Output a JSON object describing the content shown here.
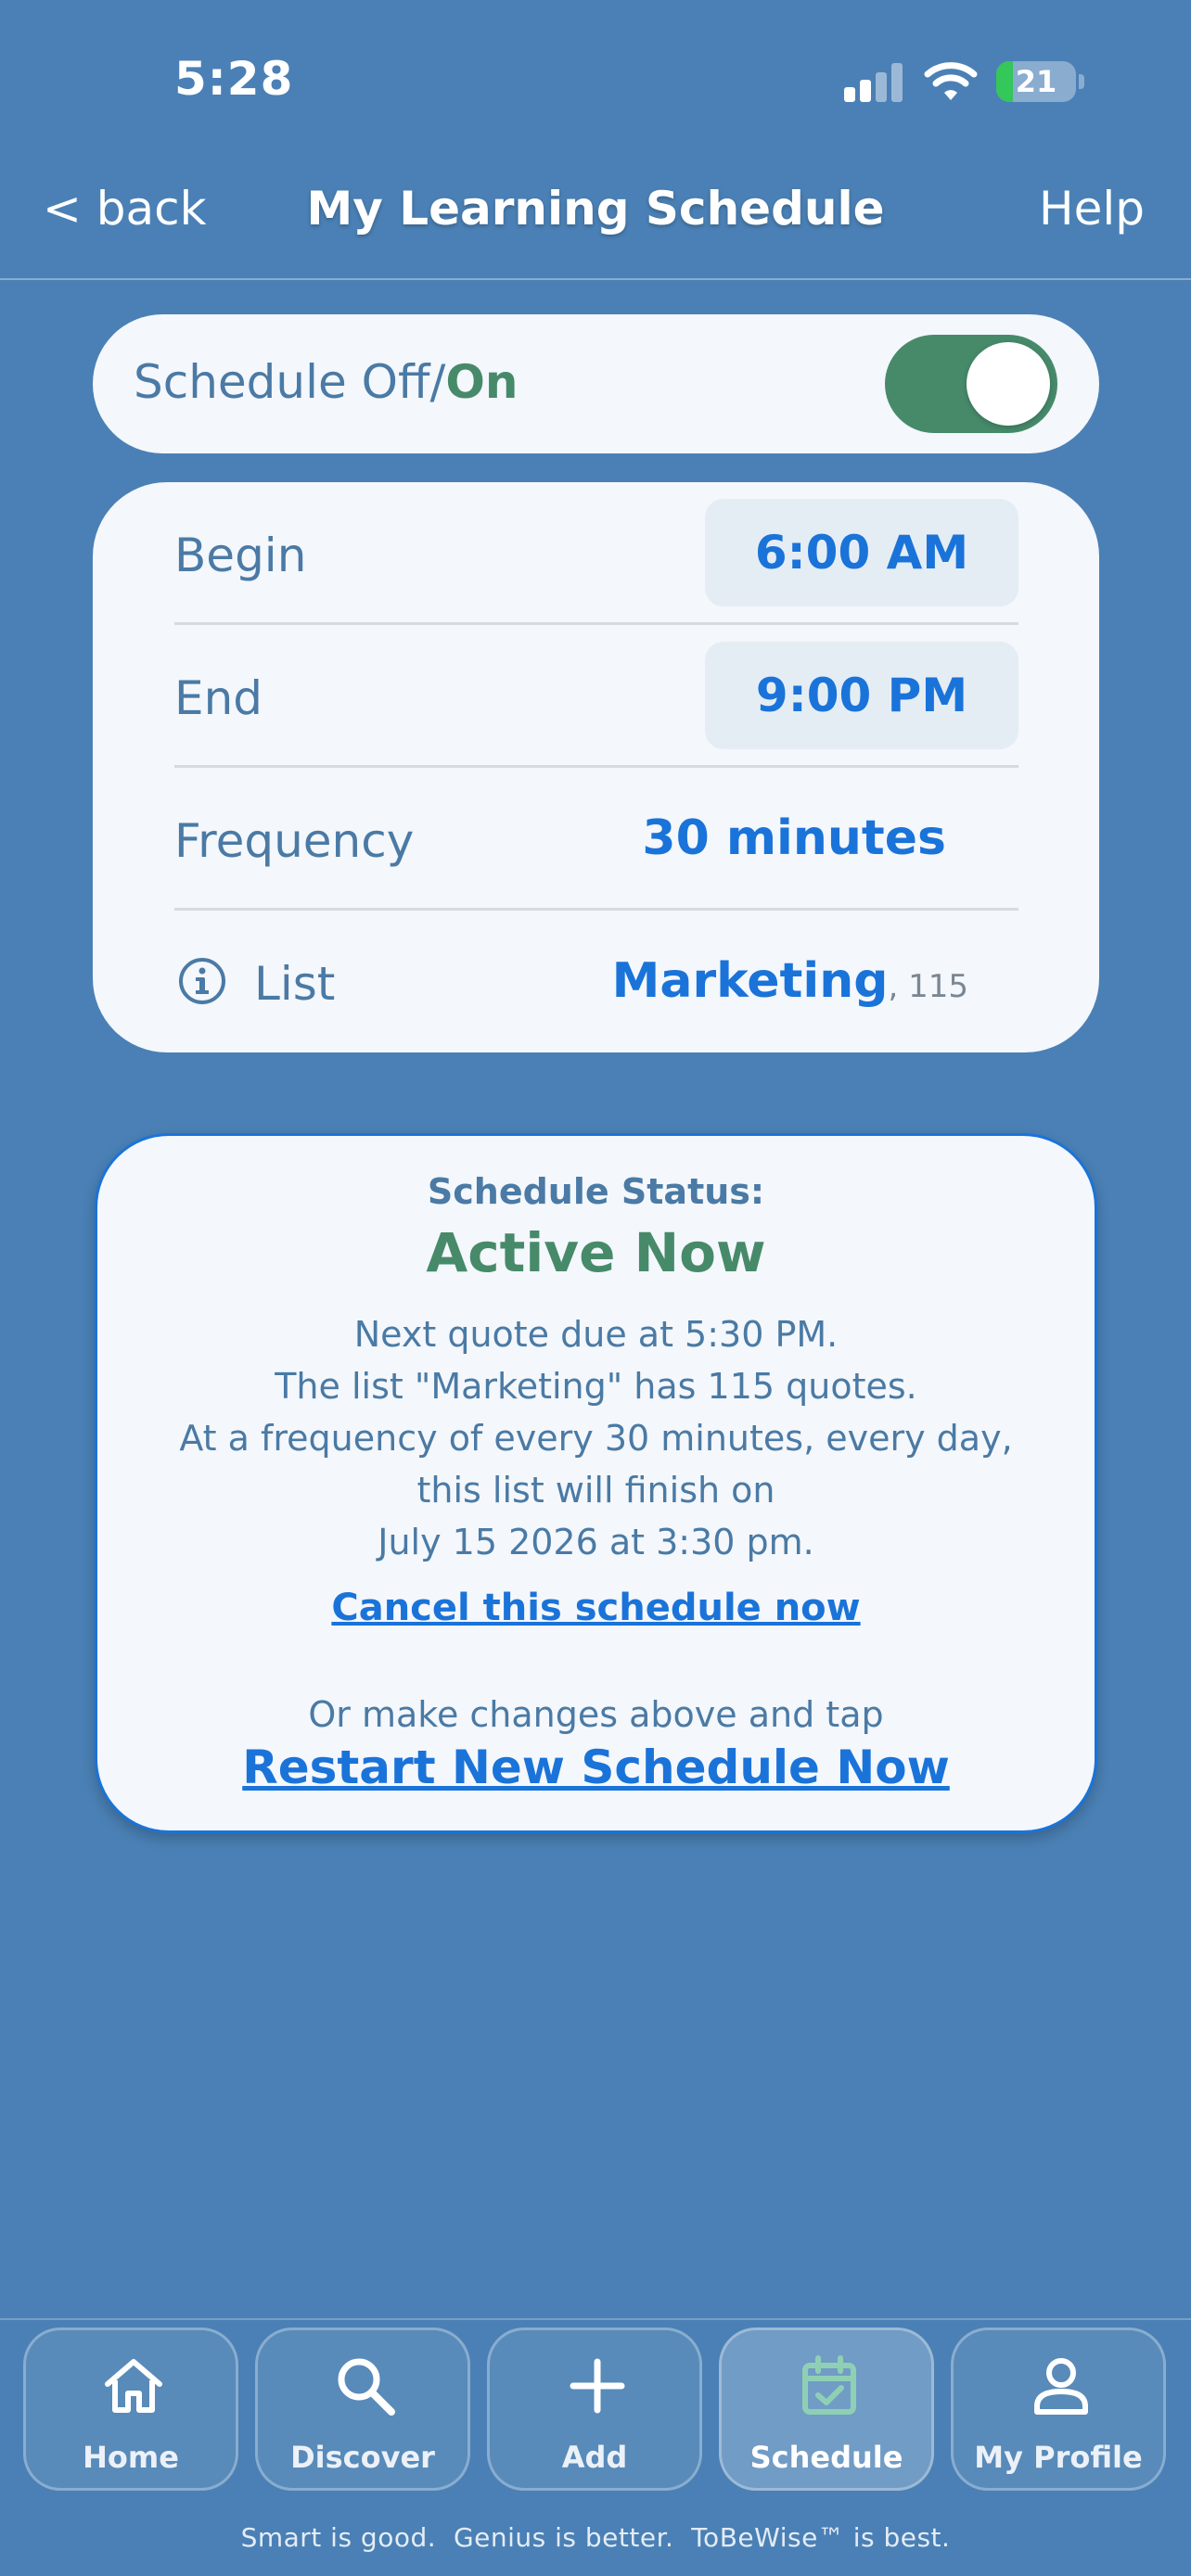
{
  "status_bar": {
    "time": "5:28",
    "battery": "21",
    "battery_level": 0.21
  },
  "nav": {
    "back_label": "< back",
    "title": "My Learning Schedule",
    "help_label": "Help"
  },
  "toggle": {
    "label_prefix": "Schedule Off/",
    "label_on": "On",
    "state": true
  },
  "settings": {
    "begin_label": "Begin",
    "begin_value": "6:00 AM",
    "end_label": "End",
    "end_value": "9:00 PM",
    "frequency_label": "Frequency",
    "frequency_value": "30 minutes",
    "list_label": "List",
    "list_name": "Marketing",
    "list_count": ", 115"
  },
  "status": {
    "heading": "Schedule Status:",
    "value": "Active Now",
    "lines": [
      "Next quote due at 5:30 PM.",
      "The list \"Marketing\" has 115 quotes.",
      "At a frequency of every 30 minutes, every day,",
      "this list will finish on",
      "July 15 2026 at 3:30 pm."
    ],
    "cancel_link": "Cancel this schedule now",
    "or_text": "Or make changes above and tap",
    "restart_link": "Restart New Schedule Now"
  },
  "tabs": [
    {
      "label": "Home",
      "icon": "home-icon"
    },
    {
      "label": "Discover",
      "icon": "search-icon"
    },
    {
      "label": "Add",
      "icon": "plus-icon"
    },
    {
      "label": "Schedule",
      "icon": "calendar-check-icon",
      "active": true
    },
    {
      "label": "My Profile",
      "icon": "person-icon"
    }
  ],
  "tagline": "Smart is good.  Genius is better.  ToBeWise™ is best.",
  "colors": {
    "background": "#4a80b5",
    "card": "#f4f7fb",
    "accent_blue": "#1a73d9",
    "accent_green": "#468a6a",
    "label_blue": "#4a7aa5",
    "schedule_icon": "#8fd0b4"
  }
}
